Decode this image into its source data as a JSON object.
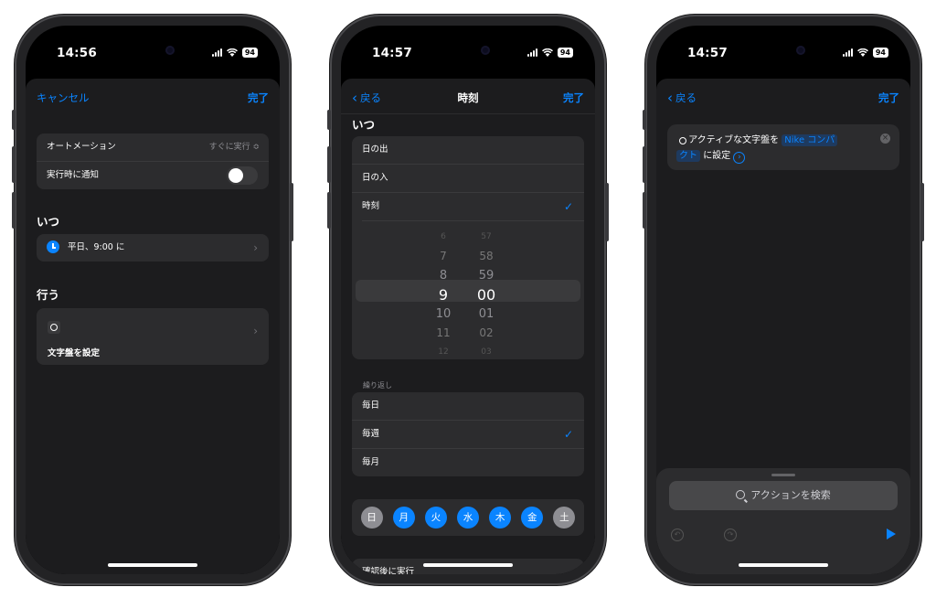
{
  "status": {
    "p1_time": "14:56",
    "p2_time": "14:57",
    "p3_time": "14:57",
    "battery": "94"
  },
  "screen1": {
    "nav": {
      "cancel": "キャンセル",
      "done": "完了"
    },
    "automation_label": "オートメーション",
    "automation_value": "すぐに実行 ≎",
    "notify_label": "実行時に通知",
    "notify_on": false,
    "when_heading": "いつ",
    "when_value": "平日、9:00 に",
    "do_heading": "行う",
    "action_label": "文字盤を設定"
  },
  "screen2": {
    "nav": {
      "back": "戻る",
      "title": "時刻",
      "done": "完了"
    },
    "when_heading": "いつ",
    "options": [
      "日の出",
      "日の入",
      "時刻"
    ],
    "selected_option": "時刻",
    "picker": {
      "hours": [
        "6",
        "7",
        "8",
        "9",
        "10",
        "11",
        "12"
      ],
      "minutes": [
        "57",
        "58",
        "59",
        "00",
        "01",
        "02",
        "03"
      ],
      "selected_hour": "9",
      "selected_minute": "00"
    },
    "repeat_label": "繰り返し",
    "repeat_options": [
      "毎日",
      "毎週",
      "毎月"
    ],
    "selected_repeat": "毎週",
    "days": [
      "日",
      "月",
      "火",
      "水",
      "木",
      "金",
      "土"
    ],
    "days_selected": [
      false,
      true,
      true,
      true,
      true,
      true,
      false
    ],
    "confirm_label": "確認後に実行"
  },
  "screen3": {
    "nav": {
      "back": "戻る",
      "done": "完了"
    },
    "action_text_1": "アクティブな文字盤を",
    "action_token_1": "Nike コンパ",
    "action_token_2": "クト",
    "action_text_2": "に設定",
    "search_placeholder": "アクションを検索"
  },
  "colors": {
    "accent": "#0a84ff",
    "background": "#000000",
    "card": "#2c2c2e"
  }
}
